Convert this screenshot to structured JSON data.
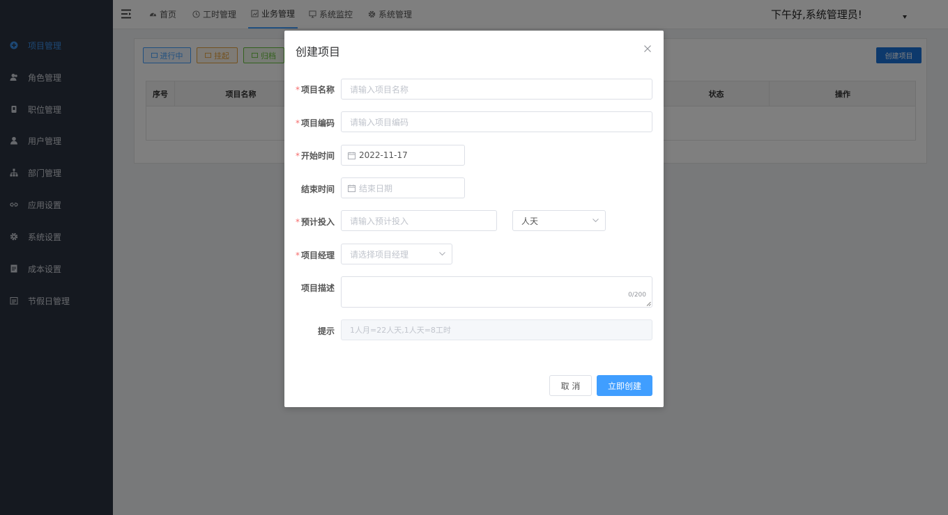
{
  "sidebar": {
    "items": [
      {
        "label": "项目管理",
        "icon": "plus-circle-icon",
        "active": true
      },
      {
        "label": "角色管理",
        "icon": "users-icon"
      },
      {
        "label": "职位管理",
        "icon": "badge-icon"
      },
      {
        "label": "用户管理",
        "icon": "user-icon"
      },
      {
        "label": "部门管理",
        "icon": "org-chart-icon"
      },
      {
        "label": "应用设置",
        "icon": "link-icon"
      },
      {
        "label": "系统设置",
        "icon": "gear-icon"
      },
      {
        "label": "成本设置",
        "icon": "document-icon"
      },
      {
        "label": "节假日管理",
        "icon": "calendar-list-icon"
      }
    ]
  },
  "topnav": {
    "tabs": [
      {
        "label": "首页",
        "icon": "dashboard-icon"
      },
      {
        "label": "工时管理",
        "icon": "clock-icon"
      },
      {
        "label": "业务管理",
        "icon": "briefcase-icon",
        "active": true
      },
      {
        "label": "系统监控",
        "icon": "monitor-icon"
      },
      {
        "label": "系统管理",
        "icon": "gear-icon"
      }
    ],
    "greeting": "下午好,系统管理员!"
  },
  "main": {
    "filters": [
      {
        "label": "进行中",
        "color": "#409eff"
      },
      {
        "label": "挂起",
        "color": "#e6a23c"
      },
      {
        "label": "归档",
        "color": "#67c23a"
      }
    ],
    "create_button": "创建项目",
    "table": {
      "columns": [
        "序号",
        "项目名称",
        "状态",
        "操作"
      ]
    }
  },
  "dialog": {
    "title": "创建项目",
    "fields": {
      "name": {
        "label": "项目名称",
        "placeholder": "请输入项目名称",
        "required": true
      },
      "code": {
        "label": "项目编码",
        "placeholder": "请输入项目编码",
        "required": true
      },
      "start": {
        "label": "开始时间",
        "value": "2022-11-17",
        "required": true
      },
      "end": {
        "label": "结束时间",
        "placeholder": "结束日期",
        "required": false
      },
      "effort": {
        "label": "预计投入",
        "placeholder": "请输入预计投入",
        "unit": "人天",
        "required": true
      },
      "manager": {
        "label": "项目经理",
        "placeholder": "请选择项目经理",
        "required": true
      },
      "description": {
        "label": "项目描述",
        "counter": "0/200",
        "required": false
      },
      "hint": {
        "label": "提示",
        "text": "1人月=22人天,1人天=8工时"
      }
    },
    "required_mark": "*",
    "cancel_label": "取 消",
    "submit_label": "立即创建"
  },
  "colors": {
    "sidebar_bg": "#2b3240",
    "primary": "#409eff",
    "required": "#f56c6c"
  }
}
